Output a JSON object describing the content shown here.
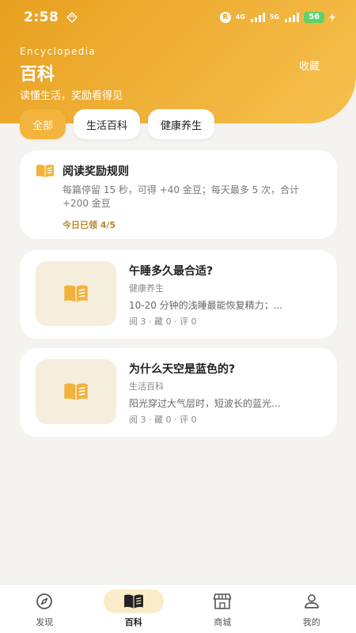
{
  "status_bar": {
    "time": "2:58",
    "net_4g": "4G",
    "net_5g": "5G",
    "battery": "56",
    "r_badge": "R"
  },
  "header": {
    "en_title": "Encyclopedia",
    "title": "百科",
    "subtitle": "读懂生活，奖励看得见",
    "favorites_label": "收藏"
  },
  "tabs": [
    {
      "label": "全部",
      "active": true
    },
    {
      "label": "生活百科",
      "active": false
    },
    {
      "label": "健康养生",
      "active": false
    }
  ],
  "reward": {
    "title": "阅读奖励规则",
    "desc": "每篇停留 15 秒，可得 +40 金豆；每天最多 5 次，合计 +200 金豆",
    "progress": "今日已领 4/5"
  },
  "articles": [
    {
      "title": "午睡多久最合适?",
      "category": "健康养生",
      "summary": "10-20 分钟的浅睡最能恢复精力；...",
      "stats": "阅 3 · 藏 0 · 评 0"
    },
    {
      "title": "为什么天空是蓝色的?",
      "category": "生活百科",
      "summary": "阳光穿过大气层时，短波长的蓝光...",
      "stats": "阅 3 · 藏 0 · 评 0"
    }
  ],
  "nav": [
    {
      "label": "发现",
      "icon": "compass-icon",
      "active": false
    },
    {
      "label": "百科",
      "icon": "book-icon",
      "active": true
    },
    {
      "label": "商城",
      "icon": "store-icon",
      "active": false
    },
    {
      "label": "我的",
      "icon": "user-icon",
      "active": false
    }
  ],
  "colors": {
    "accent": "#f2b43c",
    "header_start": "#e8a01f",
    "progress_text": "#b8862a",
    "thumb_bg": "#f6eedc"
  }
}
